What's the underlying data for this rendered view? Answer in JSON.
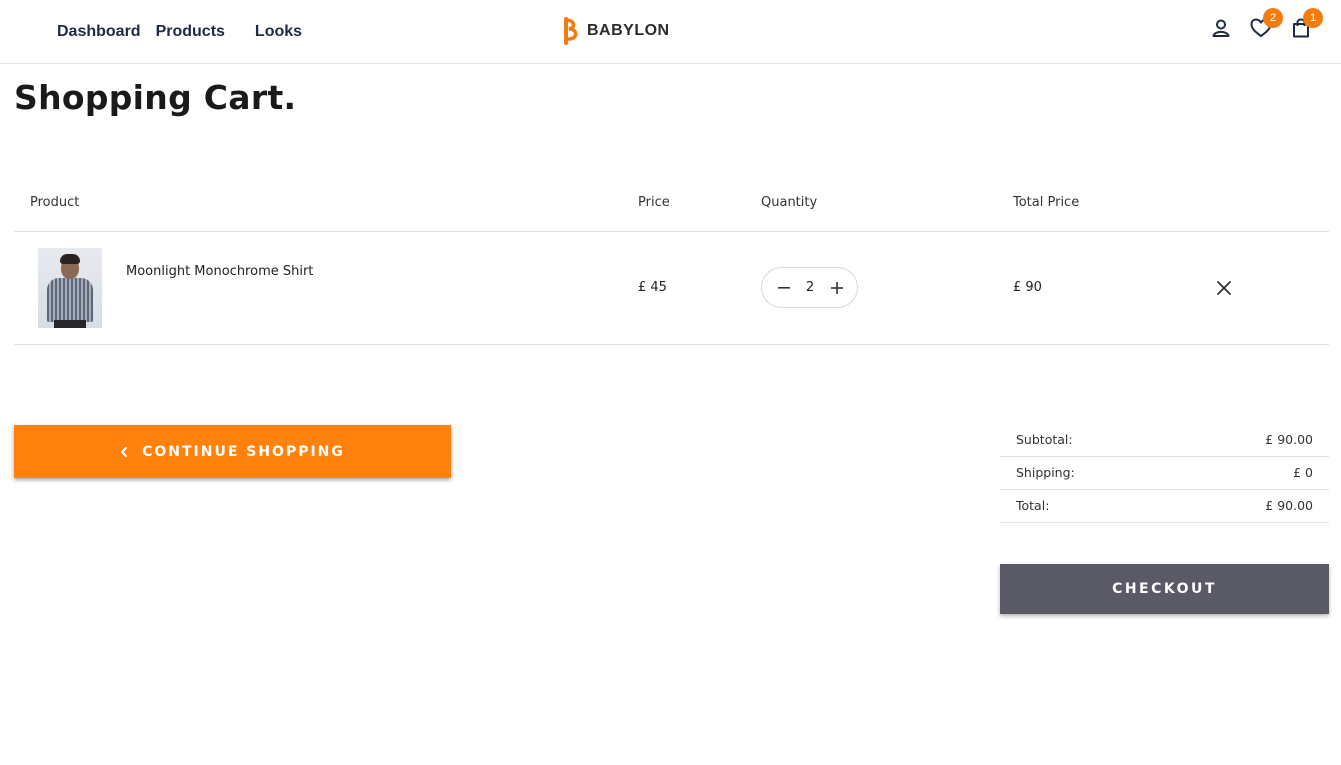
{
  "nav": {
    "items": [
      {
        "label": "Dashboard"
      },
      {
        "label": "Products"
      },
      {
        "label": "Looks"
      }
    ]
  },
  "brand": {
    "name": "BABYLON",
    "accent": "#f47b0d"
  },
  "header_icons": {
    "account": "user-icon",
    "wishlist": "heart-icon",
    "wishlist_count": "2",
    "cart": "shopping-bag-icon",
    "cart_count": "1"
  },
  "page": {
    "title": "Shopping Cart."
  },
  "table": {
    "headers": {
      "product": "Product",
      "price": "Price",
      "quantity": "Quantity",
      "total": "Total Price"
    },
    "rows": [
      {
        "name": "Moonlight Monochrome Shirt",
        "price": "£ 45",
        "quantity": "2",
        "total": "£ 90"
      }
    ]
  },
  "actions": {
    "continue_label": "CONTINUE SHOPPING",
    "continue_color": "#ff820f",
    "checkout_label": "CHECKOUT",
    "checkout_color": "#5a5a66"
  },
  "summary": {
    "subtotal_label": "Subtotal:",
    "subtotal_value": "£ 90.00",
    "shipping_label": "Shipping:",
    "shipping_value": "£ 0",
    "total_label": "Total:",
    "total_value": "£ 90.00"
  }
}
